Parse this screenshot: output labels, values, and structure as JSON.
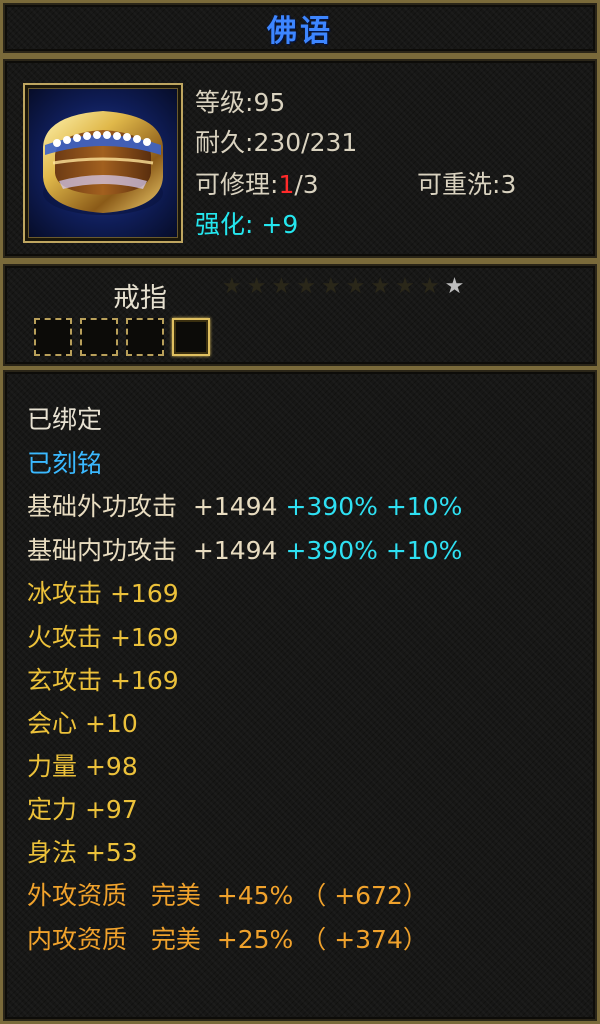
{
  "title": "佛语",
  "item": {
    "icon": "gold-diamond-ring-icon",
    "level_label": "等级:",
    "level": "95",
    "durability_label": "耐久:",
    "durability": "230/231",
    "repair_label": "可修理:",
    "repair_used": "1",
    "repair_total": "/3",
    "rewash_label": "可重洗:",
    "rewash": "3",
    "enhance_label": "强化:",
    "enhance": "+9"
  },
  "category": {
    "name": "戒指",
    "stars_total": 10,
    "stars_lit": 1,
    "slots_total": 4,
    "active_slot": 4
  },
  "attributes": {
    "bound": "已绑定",
    "engraved": "已刻铭",
    "ext_attack": {
      "label": "基础外功攻击",
      "value": "+1494",
      "pct": "+390%",
      "bonus": "+10%"
    },
    "int_attack": {
      "label": "基础内功攻击",
      "value": "+1494",
      "pct": "+390%",
      "bonus": "+10%"
    },
    "ice": {
      "label": "冰攻击",
      "value": "+169"
    },
    "fire": {
      "label": "火攻击",
      "value": "+169"
    },
    "xuan": {
      "label": "玄攻击",
      "value": "+169"
    },
    "crit": {
      "label": "会心",
      "value": "+10"
    },
    "strength": {
      "label": "力量",
      "value": "+98"
    },
    "focus": {
      "label": "定力",
      "value": "+97"
    },
    "agility": {
      "label": "身法",
      "value": "+53"
    },
    "ext_quality": {
      "label": "外攻资质",
      "grade": "完美",
      "pct": "+45%",
      "extra": "（ +672）"
    },
    "int_quality": {
      "label": "内攻资质",
      "grade": "完美",
      "pct": "+25%",
      "extra": "（ +374）"
    }
  },
  "colors": {
    "title": "#3d86ff",
    "border": "#7a6a3a",
    "bound": "#e8e2d2",
    "engraved": "#3ab9ff",
    "cyan": "#2ee0f2",
    "yellow": "#ecc13a",
    "orange": "#f0a22c",
    "red": "#ff2a2a"
  }
}
